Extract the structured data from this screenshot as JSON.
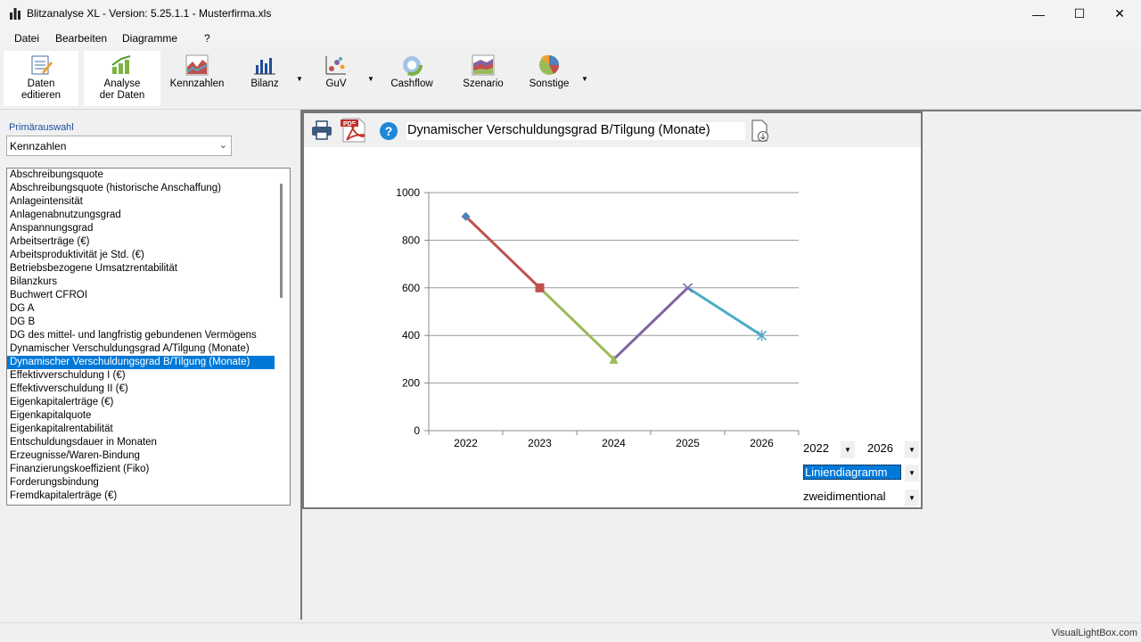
{
  "window": {
    "title": "Blitzanalyse XL - Version: 5.25.1.1 - Musterfirma.xls",
    "minimize": "—",
    "maximize": "☐",
    "close": "✕"
  },
  "menu": [
    "Datei",
    "Bearbeiten",
    "Diagramme",
    "?"
  ],
  "toolbar": {
    "daten_editieren": "Daten editieren",
    "analyse": "Analyse der Daten",
    "kennzahlen": "Kennzahlen",
    "bilanz": "Bilanz",
    "guv": "GuV",
    "cashflow": "Cashflow",
    "szenario": "Szenario",
    "sonstige": "Sonstige",
    "dropdown_arrow": "▼"
  },
  "left": {
    "primary_label": "Primärauswahl",
    "primary_value": "Kennzahlen",
    "items": [
      "Abschreibungsquote",
      "Abschreibungsquote (historische Anschaffung)",
      "Anlageintensität",
      "Anlagenabnutzungsgrad",
      "Anspannungsgrad",
      "Arbeitserträge (€)",
      "Arbeitsproduktivität je Std. (€)",
      "Betriebsbezogene Umsatzrentabilität",
      "Bilanzkurs",
      "Buchwert CFROI",
      "DG A",
      "DG B",
      "DG des mittel- und langfristig gebundenen Vermögens",
      "Dynamischer Verschuldungsgrad A/Tilgung (Monate)",
      "Dynamischer Verschuldungsgrad B/Tilgung (Monate)",
      "Effektivverschuldung I (€)",
      "Effektivverschuldung II (€)",
      "Eigenkapitalerträge (€)",
      "Eigenkapitalquote",
      "Eigenkapitalrentabilität",
      "Entschuldungsdauer in Monaten",
      "Erzeugnisse/Waren-Bindung",
      "Finanzierungskoeffizient (Fiko)",
      "Forderungsbindung",
      "Fremdkapitalerträge (€)"
    ],
    "selected_index": 14
  },
  "chart_panel": {
    "title": "Dynamischer Verschuldungsgrad B/Tilgung (Monate)",
    "year_from": "2022",
    "year_to": "2026",
    "chart_type": "Liniendiagramm",
    "dimension": "zweidimentional",
    "arrow": "▼",
    "pdf_label": "PDF"
  },
  "chart_data": {
    "type": "line",
    "categories": [
      "2022",
      "2023",
      "2024",
      "2025",
      "2026"
    ],
    "values": [
      900,
      600,
      300,
      600,
      400
    ],
    "segment_colors": [
      "#c0504d",
      "#9bbb59",
      "#8064a2",
      "#4bacc6"
    ],
    "marker_colors": [
      "#4f81bd",
      "#c0504d",
      "#9bbb59",
      "#8064a2",
      "#4bacc6"
    ],
    "markers": [
      "diamond",
      "square",
      "triangle",
      "x",
      "star"
    ],
    "yticks": [
      "0",
      "200",
      "400",
      "600",
      "800",
      "1000"
    ],
    "ylim": [
      0,
      1000
    ],
    "grid": true
  },
  "status": {
    "text": "VisualLightBox.com"
  }
}
